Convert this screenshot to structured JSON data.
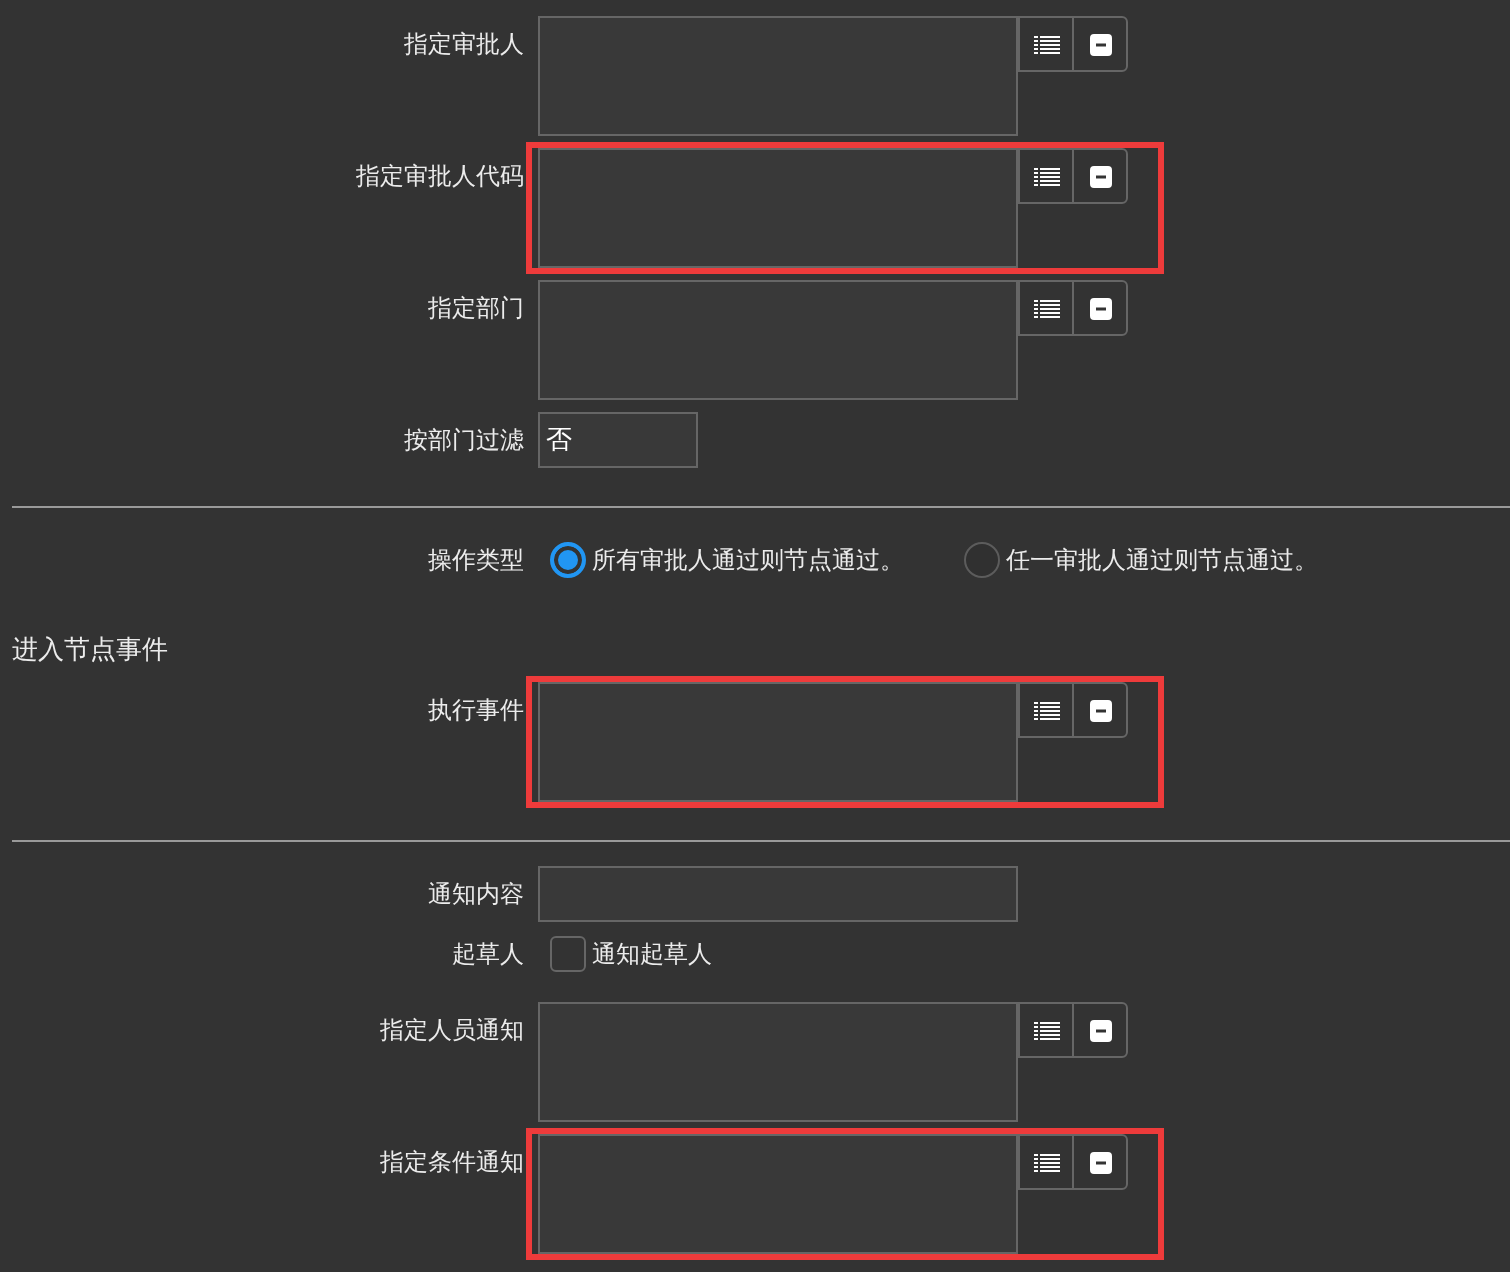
{
  "form": {
    "rows": [
      {
        "kind": "picker",
        "label": "指定审批人",
        "highlighted": false
      },
      {
        "kind": "picker",
        "label": "指定审批人代码",
        "highlighted": true
      },
      {
        "kind": "picker",
        "label": "指定部门",
        "highlighted": false
      },
      {
        "kind": "choice",
        "label": "按部门过滤",
        "value": "否"
      },
      {
        "kind": "divider"
      },
      {
        "kind": "radios",
        "label": "操作类型",
        "options": [
          {
            "label": "所有审批人通过则节点通过。",
            "selected": true
          },
          {
            "label": "任一审批人通过则节点通过。",
            "selected": false
          }
        ]
      },
      {
        "kind": "heading",
        "text": "进入节点事件"
      },
      {
        "kind": "picker",
        "label": "执行事件",
        "highlighted": true
      },
      {
        "kind": "divider"
      },
      {
        "kind": "text",
        "label": "通知内容"
      },
      {
        "kind": "checkbox",
        "label": "起草人",
        "option": "通知起草人",
        "checked": false
      },
      {
        "kind": "picker",
        "label": "指定人员通知",
        "highlighted": false
      },
      {
        "kind": "picker",
        "label": "指定条件通知",
        "highlighted": true
      }
    ]
  }
}
